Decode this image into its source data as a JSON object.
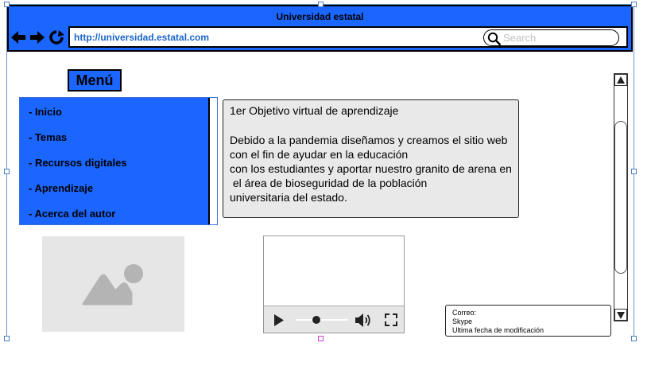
{
  "window": {
    "title": "Universidad estatal"
  },
  "navbar": {
    "icons": [
      "back-arrow-icon",
      "forward-arrow-icon",
      "reload-icon"
    ],
    "url": "http://universidad.estatal.com",
    "search_placeholder": "Search"
  },
  "menu": {
    "title": "Menú",
    "items": [
      {
        "label": "- Inicio"
      },
      {
        "label": "- Temas"
      },
      {
        "label": "- Recursos digitales"
      },
      {
        "label": "- Aprendizaje"
      },
      {
        "label": "- Acerca del autor"
      }
    ]
  },
  "panel": {
    "title": "1er Objetivo virtual de aprendizaje",
    "body": "Debido a la pandemia diseñamos y creamos el sitio web\ncon el fin de ayudar en la educación\ncon los estudiantes y aportar nuestro granito de arena en\n el área de bioseguridad de la población\nuniversitaria del estado."
  },
  "media": {
    "image_icon": "image-placeholder-icon",
    "video_icons": [
      "play-icon",
      "volume-icon",
      "fullscreen-icon"
    ],
    "video_progress": 0.4
  },
  "footer": {
    "lines": [
      "Correo:",
      "Skype",
      "Ultima fecha de modificación"
    ]
  },
  "colors": {
    "accent": "#1a66ff",
    "panel_bg": "#e9e9e9",
    "url_text": "#1a66c8"
  }
}
